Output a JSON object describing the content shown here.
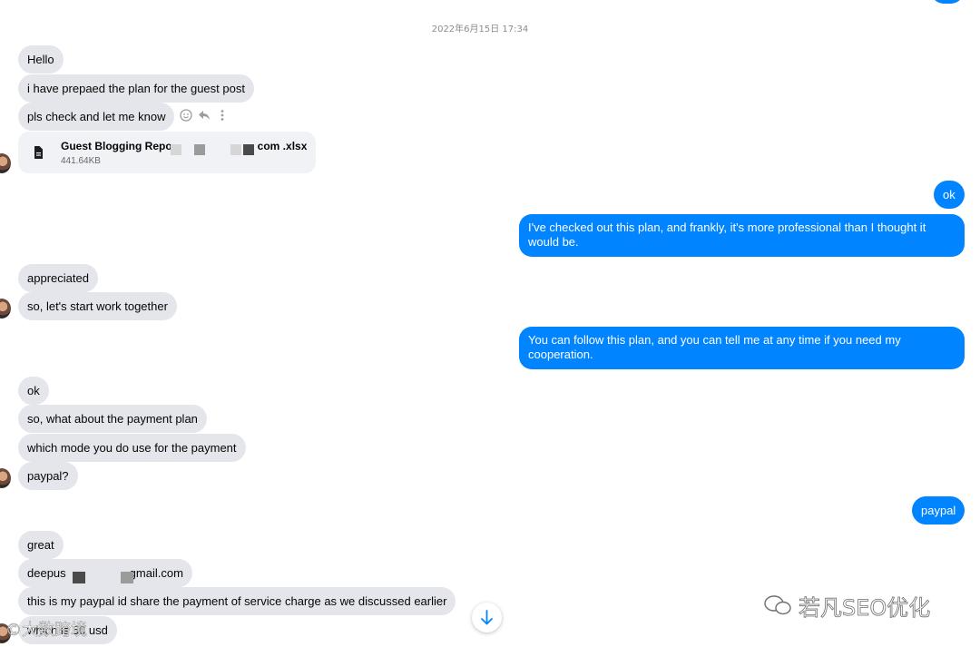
{
  "timestamp": "2022年6月15日 17:34",
  "incoming_group_1": [
    "Hello",
    "i have prepaed the plan for the guest post",
    "pls check and let me know"
  ],
  "file": {
    "name_start": "Guest Blogging Repo",
    "name_end": "com .xlsx",
    "size": "441.64KB",
    "icon": "document-icon"
  },
  "hover_actions": [
    "emoji-icon",
    "reply-icon",
    "more-icon"
  ],
  "outgoing_1": {
    "ok": "ok",
    "checked": "I've checked out this plan, and frankly, it's more professional than I thought it would be."
  },
  "incoming_group_2": [
    "appreciated",
    "so, let's start work together"
  ],
  "outgoing_2": "You can follow this plan, and you can tell me at any time if you need my cooperation.",
  "incoming_group_3": [
    "ok",
    "so, what about the payment plan",
    "which mode you do use for the payment",
    "paypal?"
  ],
  "outgoing_3": "paypal",
  "incoming_group_4": {
    "great": "great",
    "email_start": "deepus",
    "email_end": "gmail.com",
    "paypal_id": "this is my paypal id share the payment of service charge as we discussed earlier",
    "amount": "which is 50 usd"
  },
  "watermark_left": "©大数跨境",
  "watermark_right": "若凡SEO优化",
  "colors": {
    "outgoing_bubble": "#0084ff",
    "incoming_bubble": "#e4e6eb",
    "file_card": "#f0f2f5"
  }
}
